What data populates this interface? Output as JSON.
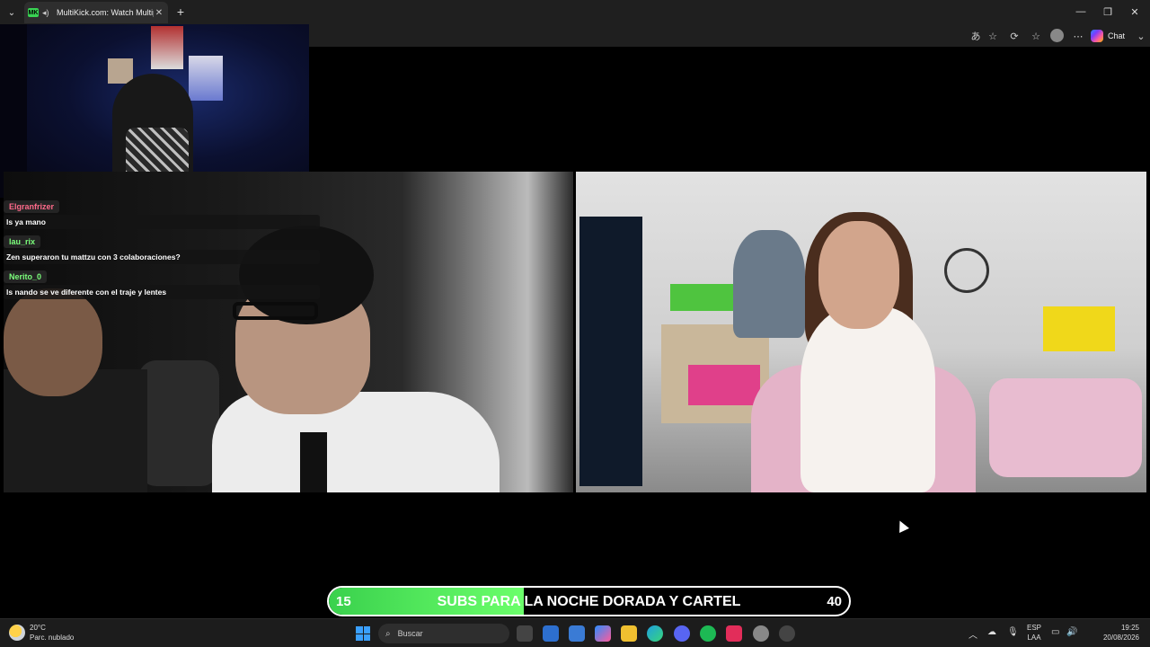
{
  "browser": {
    "tab_title": "MultiKick.com: Watch Multiple",
    "favicon_text": "MK",
    "new_tab": "+",
    "chat_label": "Chat"
  },
  "chat": [
    {
      "user": "Elgranfrizer",
      "user_color": "#ff6a8a",
      "message": "ls ya mano"
    },
    {
      "user": "lau_rix",
      "user_color": "#7cff7c",
      "message": "Zen superaron tu mattzu con 3 colaboraciones?"
    },
    {
      "user": "Nerito_0",
      "user_color": "#7cff7c",
      "message": "ls nando se ve diferente con el traje y lentes"
    }
  ],
  "sub_goal": {
    "current": "15",
    "label": "SUBS PARA LA NOCHE DORADA Y CARTEL",
    "target": "40",
    "progress": 0.375
  },
  "taskbar": {
    "temperature": "20°C",
    "weather": "Parc. nublado",
    "search_placeholder": "Buscar",
    "lang_top": "ESP",
    "lang_bottom": "LAA",
    "time": "19:25",
    "date": "20/08/2026"
  },
  "colors": {
    "accent_green": "#3ad14d",
    "browser_bg": "#1f1f1f",
    "taskbar_bg": "#1c1c1c"
  }
}
